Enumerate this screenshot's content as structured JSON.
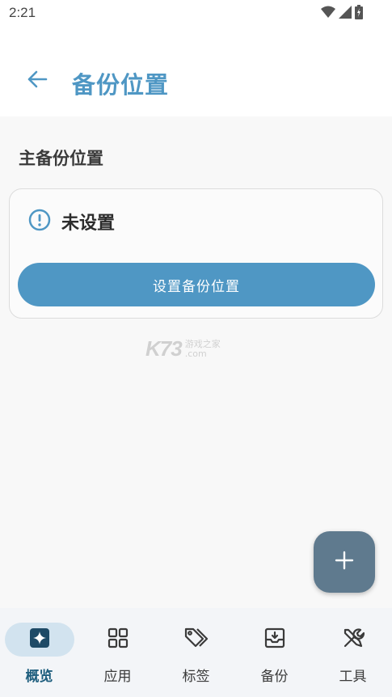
{
  "status_bar": {
    "time": "2:21"
  },
  "app_bar": {
    "title": "备份位置"
  },
  "section": {
    "title": "主备份位置"
  },
  "card": {
    "status_text": "未设置",
    "button_label": "设置备份位置"
  },
  "watermark": {
    "main": "K73",
    "sub_top": "游戏之家",
    "sub_bottom": ".com"
  },
  "nav": {
    "items": [
      {
        "label": "概览",
        "icon": "sparkle-icon",
        "active": true
      },
      {
        "label": "应用",
        "icon": "apps-grid-icon",
        "active": false
      },
      {
        "label": "标签",
        "icon": "tags-icon",
        "active": false
      },
      {
        "label": "备份",
        "icon": "archive-icon",
        "active": false
      },
      {
        "label": "工具",
        "icon": "tools-icon",
        "active": false
      }
    ]
  },
  "colors": {
    "accent": "#4f97c4",
    "fab": "#5f7a8e",
    "nav_active": "#d2e3ef",
    "nav_active_text": "#1e5e7e"
  }
}
